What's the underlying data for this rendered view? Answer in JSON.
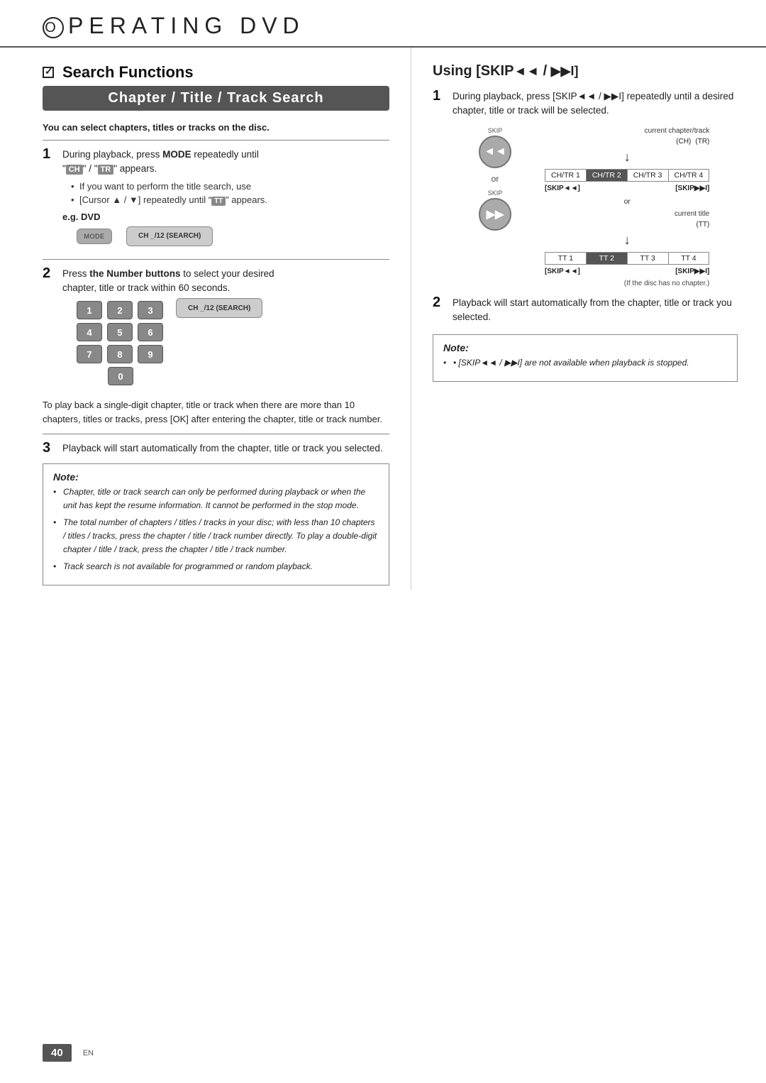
{
  "header": {
    "circle_letter": "O",
    "title": "PERATING   DVD"
  },
  "left": {
    "section_checkbox": "✓",
    "section_title": "Search Functions",
    "banner": "Chapter / Title / Track Search",
    "bold_note": "You can select chapters, titles or tracks on the disc.",
    "step1": {
      "num": "1",
      "text1": "During playback, press ",
      "text1b": "MODE",
      "text1c": " repeatedly until",
      "text2a": "“",
      "text2b": "CH",
      "text2c": "” / “",
      "text2d": "TR",
      "text2e": "” appears.",
      "sub1": "If you want to perform the title search, use",
      "sub2_start": "[Cursor ▲ / ▼] repeatedly until “",
      "sub2_mid": "TT",
      "sub2_end": "” appears.",
      "eg_label": "e.g.",
      "eg_sub": "DVD",
      "mode_btn": "MODE",
      "display_text": "CH  _/12 (SEARCH)"
    },
    "step2": {
      "num": "2",
      "text1": "Press ",
      "text1b": "the Number buttons",
      "text1c": " to select your desired",
      "text2": "chapter, title or track within 60 seconds.",
      "buttons": [
        "1",
        "2",
        "3",
        "4",
        "5",
        "6",
        "7",
        "8",
        "9",
        "0"
      ],
      "display_text": "CH  _/12 (SEARCH)"
    },
    "para": "To play back a single-digit chapter, title or track when there are more than 10 chapters, titles or tracks, press [OK] after entering the chapter, title or track number.",
    "step3": {
      "num": "3",
      "text": "Playback will start automatically from the chapter, title or track you selected."
    },
    "note": {
      "title": "Note:",
      "items": [
        "Chapter, title or track search can only be performed during playback or when the unit has kept the resume information. It cannot be performed in the stop mode.",
        "The total number of chapters / titles / tracks in your disc; with less than 10 chapters / titles / tracks, press the chapter / title / track number directly. To play a double-digit chapter / title / track, press the chapter / title / track number.",
        "Track search is not available for programmed or random playback."
      ]
    }
  },
  "right": {
    "using_title": "Using [SKIP",
    "using_skip_left": "◄◄",
    "using_separator": " / ",
    "using_skip_right": "▶▶I]",
    "step1": {
      "num": "1",
      "text": "During playback, press [SKIP◄◄ / ▶▶I] repeatedly until a desired chapter, title or track will be selected.",
      "current_chapter_track": "current chapter/track",
      "ch_label": "(CH)",
      "tr_label": "(TR)",
      "skip_left_label": "[SKIP◄◄]",
      "skip_right_label": "[SKIP▶▶I]",
      "or_text": "or",
      "skip_left_btn": "◄◄",
      "skip_right_btn": "▶▶",
      "skip_left_word": "SKIP",
      "skip_right_word": "SKIP",
      "ch_tr_row": [
        "CH/TR 1",
        "CH/TR 2",
        "CH/TR 3",
        "CH/TR 4"
      ],
      "current_title": "current title",
      "tt_label": "(TT)",
      "tt_row": [
        "TT 1",
        "TT 2",
        "TT 3",
        "TT 4"
      ],
      "skip_left_label2": "[SKIP◄◄]",
      "skip_right_label2": "[SKIP▶▶I]",
      "no_chapter_note": "(If the disc has no chapter.)"
    },
    "step2": {
      "num": "2",
      "text": "Playback will start automatically from the chapter, title or track you selected."
    },
    "note": {
      "title": "Note:",
      "item": "[SKIP◄◄ / ▶▶I] are not available when playback is stopped."
    }
  },
  "footer": {
    "page_num": "40",
    "lang": "EN"
  }
}
